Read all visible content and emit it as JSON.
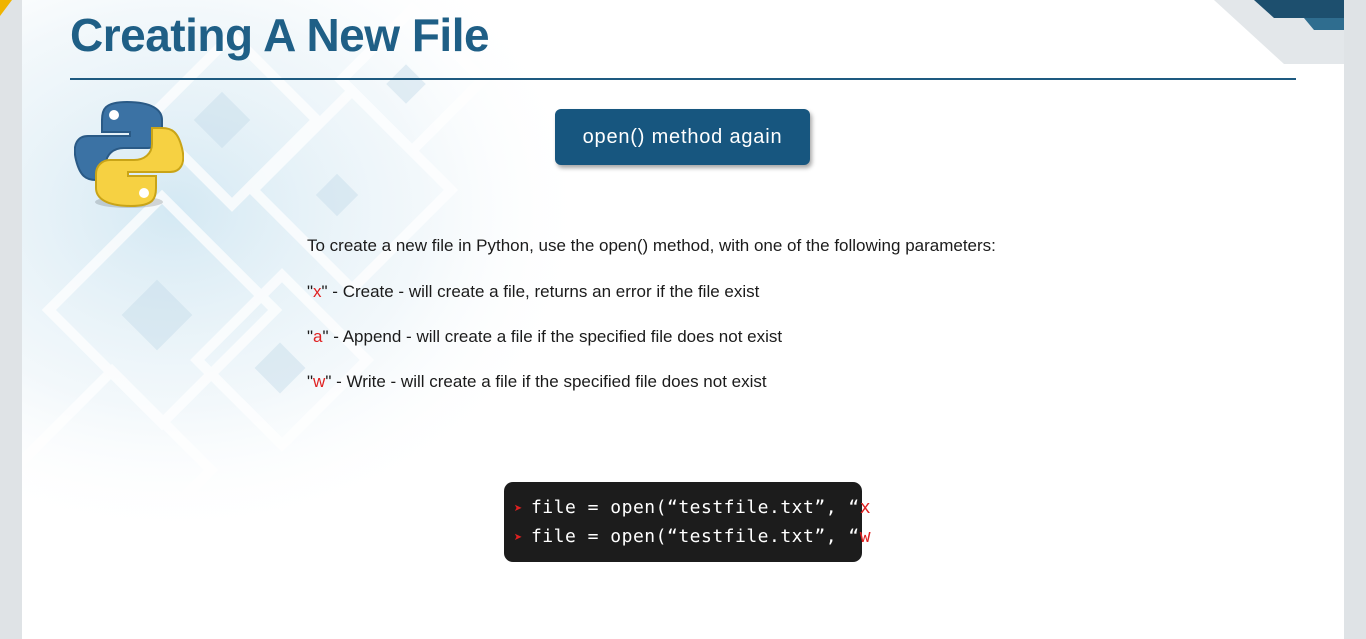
{
  "slide": {
    "title": "Creating A New File",
    "subtitle_button": "open() method again",
    "intro": "To create a new file in Python, use the open() method, with one of the following parameters:",
    "params": [
      {
        "open_quote": "\"",
        "mode": "x",
        "rest": "\" - Create - will create a file, returns an error if the file exist"
      },
      {
        "open_quote": "\"",
        "mode": "a",
        "rest": "\" - Append - will create a file if the specified file does not exist"
      },
      {
        "open_quote": "\"",
        "mode": "w",
        "rest": "\" - Write - will create a file if the specified file does not exist"
      }
    ],
    "code": [
      {
        "bullet": "➤",
        "prefix": "file = open(“testfile.txt”, “",
        "mode": "x",
        "suffix": "”)"
      },
      {
        "bullet": "➤",
        "prefix": "file = open(“testfile.txt”, “",
        "mode": "w",
        "suffix": "”)"
      }
    ]
  },
  "colors": {
    "title": "#1f5f86",
    "accent_button": "#17567f",
    "highlight_red": "#e02121",
    "code_background": "#1c1c1c"
  },
  "icons": [
    "python-logo-icon",
    "arrow-bullet-icon"
  ]
}
